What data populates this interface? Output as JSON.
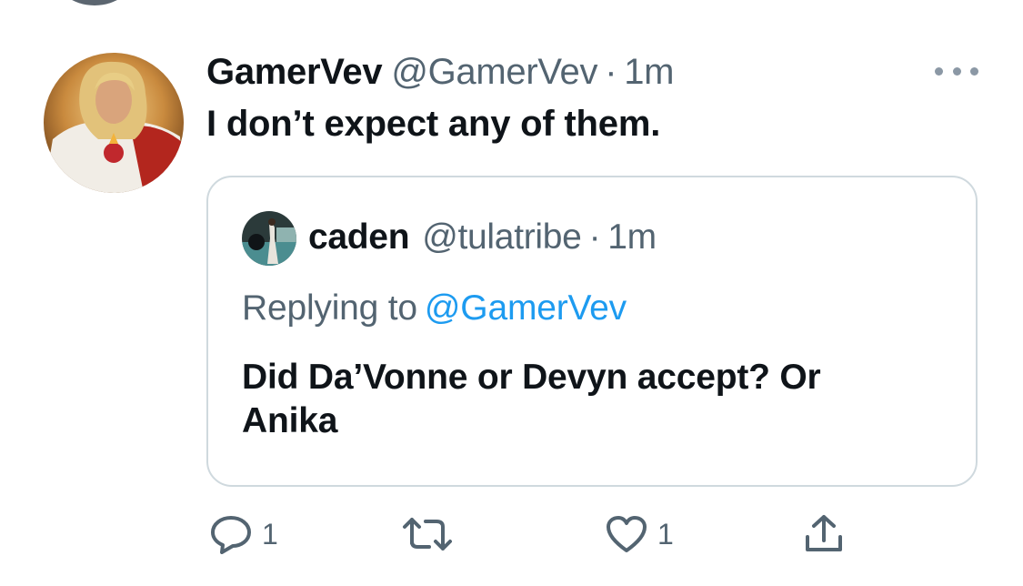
{
  "tweet": {
    "display_name": "GamerVev",
    "handle": "@GamerVev",
    "separator": "·",
    "time": "1m",
    "text": "I don’t expect any of them."
  },
  "quoted_tweet": {
    "display_name": "caden",
    "handle": "@tulatribe",
    "separator": "·",
    "time": "1m",
    "replying_label": "Replying to",
    "replying_to": "@GamerVev",
    "text_lines": [
      "Did Da’Vonne or Devyn accept? Or",
      "Anika"
    ]
  },
  "actions": {
    "reply_count": "1",
    "like_count": "1"
  },
  "icons": {
    "more": "more-options-icon",
    "reply": "reply-icon",
    "retweet": "retweet-icon",
    "like": "heart-icon",
    "share": "share-icon"
  },
  "colors": {
    "text_primary": "#0f1419",
    "text_secondary": "#536471",
    "link": "#1d9bf0",
    "border": "#cfd9de"
  }
}
